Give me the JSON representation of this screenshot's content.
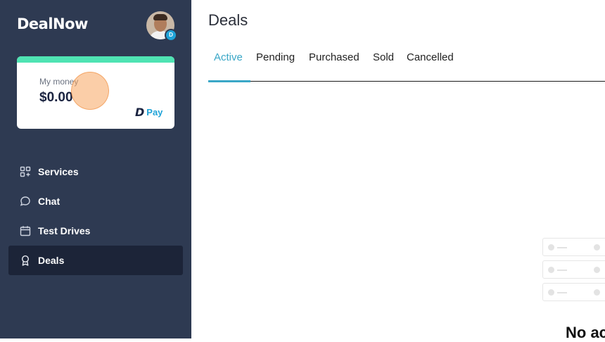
{
  "brand": {
    "logo_text": "DealNow"
  },
  "account": {
    "avatar_badge": "D"
  },
  "money_card": {
    "label": "My money",
    "value": "$0.00",
    "pay_mark": "D",
    "pay_text": "Pay",
    "accent_color": "#4fe3b3"
  },
  "sidebar": {
    "items": [
      {
        "label": "Services",
        "icon": "grid-plus-icon"
      },
      {
        "label": "Chat",
        "icon": "chat-bubble-icon"
      },
      {
        "label": "Test Drives",
        "icon": "calendar-icon"
      },
      {
        "label": "Deals",
        "icon": "award-ribbon-icon",
        "active": true
      }
    ]
  },
  "main": {
    "title": "Deals",
    "tabs": [
      {
        "label": "Active",
        "active": true
      },
      {
        "label": "Pending"
      },
      {
        "label": "Purchased"
      },
      {
        "label": "Sold"
      },
      {
        "label": "Cancelled"
      }
    ],
    "empty_state_title": "No ac"
  },
  "colors": {
    "sidebar_bg": "#2e3a52",
    "active_nav_bg": "#1c2438",
    "tab_accent": "#3aa7c7"
  }
}
